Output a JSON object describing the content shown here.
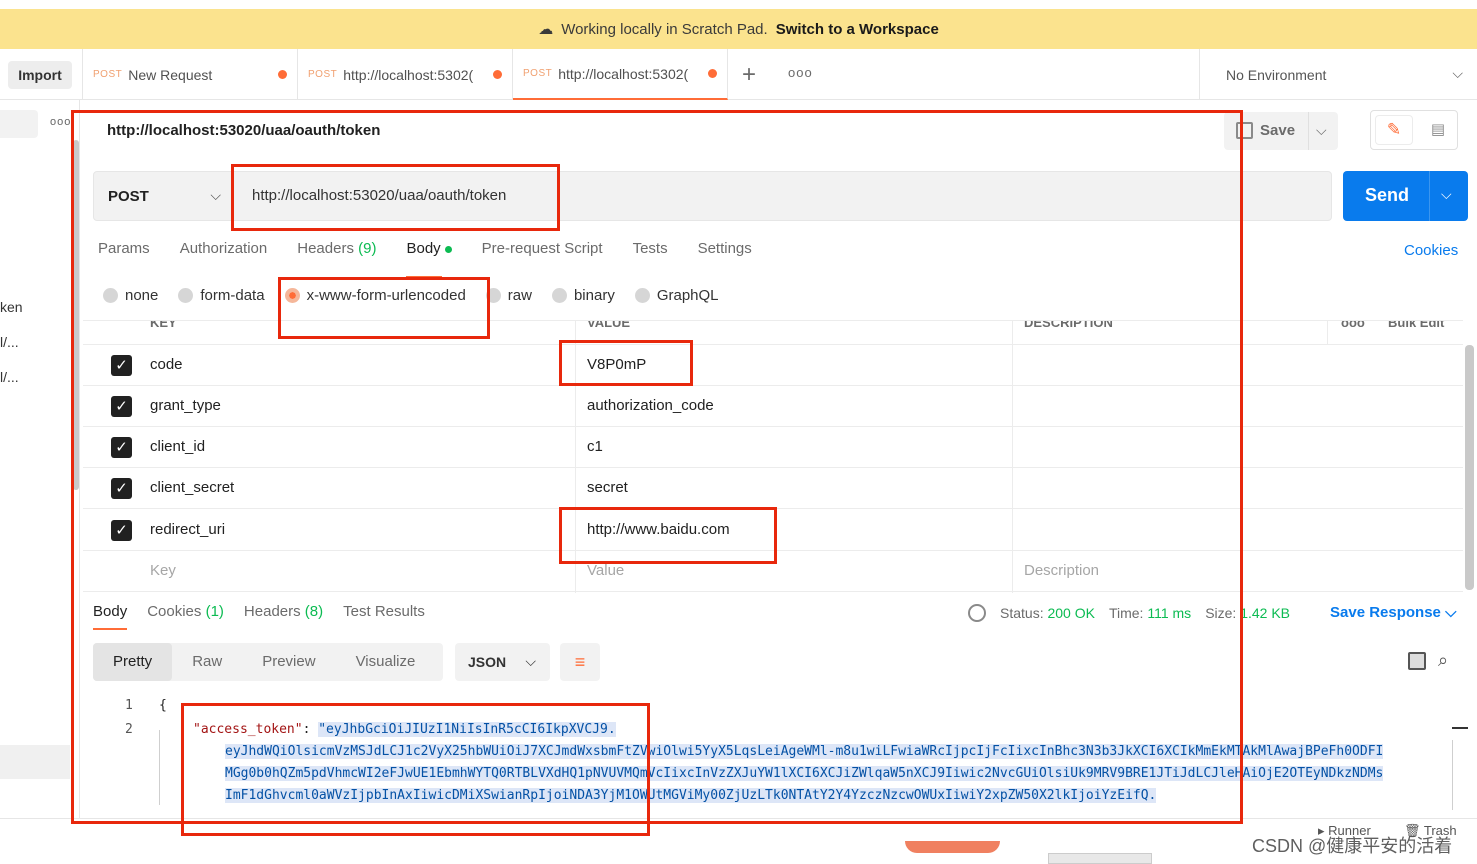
{
  "banner": {
    "text": "Working locally in Scratch Pad.",
    "link": "Switch to a Workspace"
  },
  "toolbar": {
    "import_label": "Import"
  },
  "tabs": [
    {
      "method": "POST",
      "title": "New Request"
    },
    {
      "method": "POST",
      "title": "http://localhost:5302("
    },
    {
      "method": "POST",
      "title": "http://localhost:5302("
    }
  ],
  "environment": {
    "selected": "No Environment"
  },
  "sidebar": {
    "items": [
      "ken",
      "l/...",
      "l/..."
    ]
  },
  "request": {
    "name": "http://localhost:53020/uaa/oauth/token",
    "method": "POST",
    "url": "http://localhost:53020/uaa/oauth/token",
    "save_label": "Save",
    "send_label": "Send"
  },
  "request_tabs": {
    "params": "Params",
    "authorization": "Authorization",
    "headers": "Headers",
    "headers_count": "(9)",
    "body": "Body",
    "prerequest": "Pre-request Script",
    "tests": "Tests",
    "settings": "Settings",
    "cookies": "Cookies"
  },
  "body_types": [
    "none",
    "form-data",
    "x-www-form-urlencoded",
    "raw",
    "binary",
    "GraphQL"
  ],
  "params_table": {
    "headers": [
      "KEY",
      "VALUE",
      "DESCRIPTION",
      "ooo",
      "Bulk Edit"
    ],
    "rows": [
      {
        "key": "code",
        "value": "V8P0mP"
      },
      {
        "key": "grant_type",
        "value": "authorization_code"
      },
      {
        "key": "client_id",
        "value": "c1"
      },
      {
        "key": "client_secret",
        "value": "secret"
      },
      {
        "key": "redirect_uri",
        "value": "http://www.baidu.com"
      }
    ],
    "placeholders": {
      "key": "Key",
      "value": "Value",
      "description": "Description"
    }
  },
  "response": {
    "tabs": {
      "body": "Body",
      "cookies": "Cookies",
      "cookies_count": "(1)",
      "headers": "Headers",
      "headers_count": "(8)",
      "tests": "Test Results"
    },
    "status_label": "Status:",
    "status": "200 OK",
    "time_label": "Time:",
    "time": "111 ms",
    "size_label": "Size:",
    "size": "1.42 KB",
    "save_response": "Save Response",
    "views": [
      "Pretty",
      "Raw",
      "Preview",
      "Visualize"
    ],
    "format": "JSON",
    "code": {
      "line1": "{",
      "key": "\"access_token\"",
      "colon": ": ",
      "val1": "\"eyJhbGciOiJIUzI1NiIsInR5cCI6IkpXVCJ9.",
      "val2": "eyJhdWQiOlsicmVzMSJdLCJ1c2VyX25hbWUiOiJ7XCJmdWxsbmFtZVwiOlwi5YyX5LqsLeiAgeWMl-m8u1wiLFwiaWRcIjpcIjFcIixcInBhc3N3b3JkXCI6XCIkMmEkMTAkMlAwajBPeFh0ODFI",
      "val3": "MGg0b0hQZm5pdVhmcWI2eFJwUE1EbmhWYTQ0RTBLVXdHQ1pNVUVMQmVcIixcInVzZXJuYW1lXCI6XCJiZWlqaW5nXCJ9Iiwic2NvcGUiOlsiUk9MRV9BRE1JTiJdLCJleHAiOjE2OTEyNDkzNDMs",
      "val4": "ImF1dGhvcml0aWVzIjpbInAxIiwicDMiXSwianRpIjoiNDA3YjM1OWUtMGViMy00ZjUzLTk0NTAtY2Y4YzczNzcwOWUxIiwiY2xpZW50X2lkIjoiYzEifQ."
    }
  },
  "footer": {
    "runner": "Runner",
    "trash": "Trash"
  },
  "watermark": "CSDN @健康平安的活着",
  "colors": {
    "accent": "#ff6c37",
    "send": "#097bed",
    "annotation": "#e8280c",
    "banner": "#fbe38e"
  }
}
